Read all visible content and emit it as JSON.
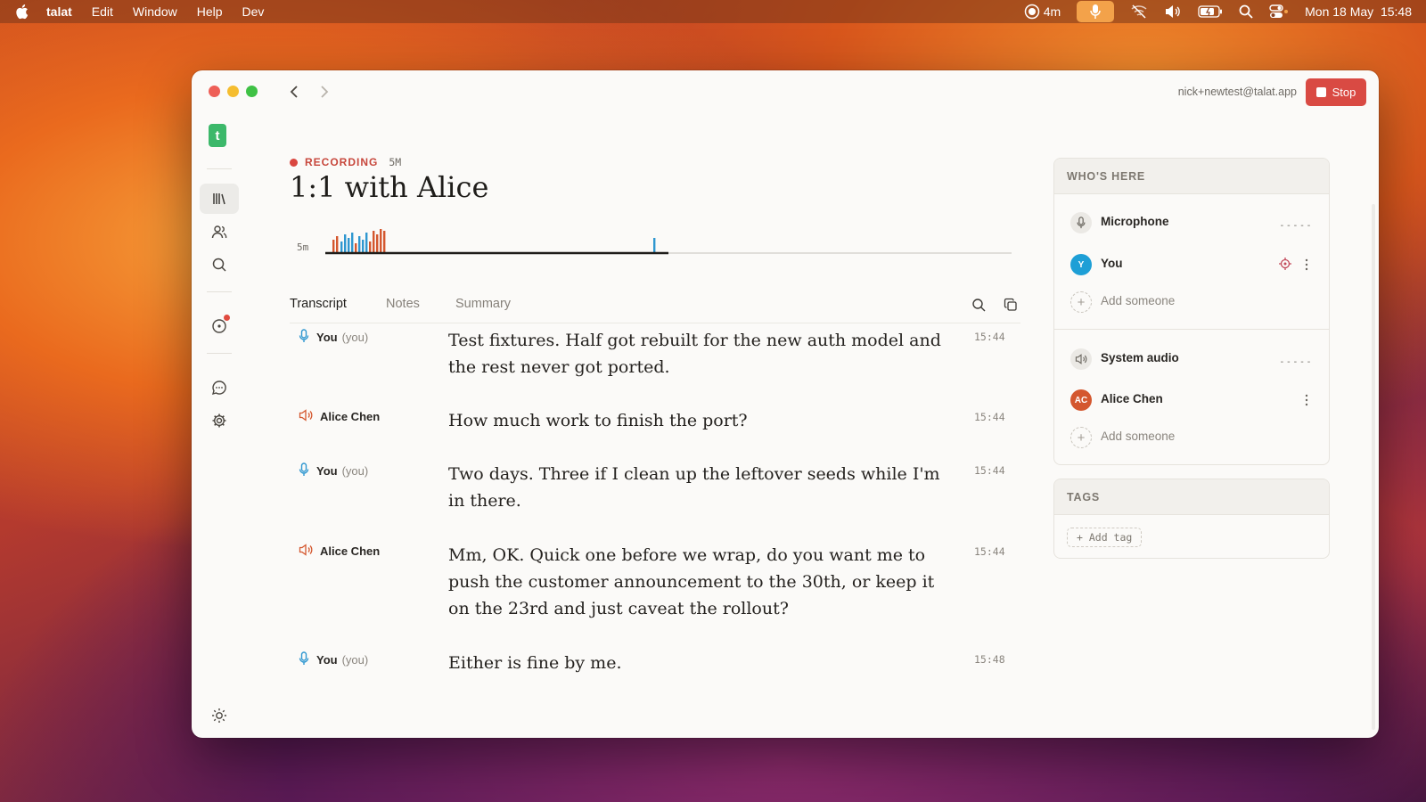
{
  "menubar": {
    "app_name": "talat",
    "menus": [
      "Edit",
      "Window",
      "Help",
      "Dev"
    ],
    "recording_indicator": "4m",
    "datetime": "Mon 18 May  15:48"
  },
  "window": {
    "account_email": "nick+newtest@talat.app",
    "stop_label": "Stop"
  },
  "sidebar": {
    "logo_letter": "t",
    "items": [
      "library",
      "people",
      "search",
      "activity",
      "chat",
      "settings"
    ]
  },
  "meeting": {
    "status": "RECORDING",
    "duration": "5M",
    "title": "1:1 with Alice",
    "timeline_label": "5m",
    "progress_fraction": 0.5
  },
  "tabs": [
    "Transcript",
    "Notes",
    "Summary"
  ],
  "transcript": [
    {
      "speaker": "You",
      "tag": "(you)",
      "source": "mic",
      "text": "Test fixtures. Half got rebuilt for the new auth model and the rest never got ported.",
      "time": "15:44"
    },
    {
      "speaker": "Alice Chen",
      "tag": "",
      "source": "system",
      "text": "How much work to finish the port?",
      "time": "15:44"
    },
    {
      "speaker": "You",
      "tag": "(you)",
      "source": "mic",
      "text": "Two days. Three if I clean up the leftover seeds while I'm in there.",
      "time": "15:44"
    },
    {
      "speaker": "Alice Chen",
      "tag": "",
      "source": "system",
      "text": "Mm, OK. Quick one before we wrap, do you want me to push the customer announcement to the 30th, or keep it on the 23rd and just caveat the rollout?",
      "time": "15:44"
    },
    {
      "speaker": "You",
      "tag": "(you)",
      "source": "mic",
      "text": "Either is fine by me.",
      "time": "15:48"
    }
  ],
  "whos_here": {
    "heading": "WHO'S HERE",
    "microphone": {
      "label": "Microphone",
      "level": "-----"
    },
    "you": {
      "initial": "Y",
      "name": "You",
      "color": "#1e9fd6"
    },
    "add_someone_1": "Add someone",
    "system_audio": {
      "label": "System audio",
      "level": "-----"
    },
    "alice": {
      "initials": "AC",
      "name": "Alice Chen",
      "color": "#d4572e"
    },
    "add_someone_2": "Add someone"
  },
  "tags": {
    "heading": "TAGS",
    "add_tag": "+ Add tag"
  },
  "colors": {
    "accent_red": "#d94a43",
    "mic_blue": "#2f97d0",
    "speaker_orange": "#d4572e",
    "logo_green": "#3cb86a"
  }
}
